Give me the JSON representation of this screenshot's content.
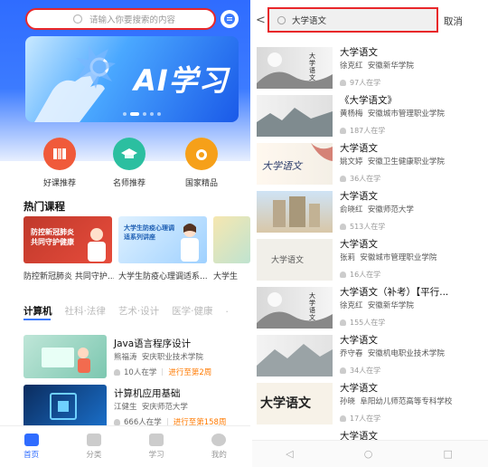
{
  "left": {
    "search": {
      "placeholder": "请输入你要搜索的内容"
    },
    "banner": {
      "text": "AI学习"
    },
    "quick_links": [
      {
        "label": "好课推荐",
        "icon": "books-icon",
        "color": "#f05a3a"
      },
      {
        "label": "名师推荐",
        "icon": "graduation-cap-icon",
        "color": "#2bbfa0"
      },
      {
        "label": "国家精品",
        "icon": "medal-icon",
        "color": "#f6a019"
      }
    ],
    "hot_title": "热门课程",
    "hot_courses": [
      {
        "caption": "防控新冠肺炎 共同守护...",
        "card_text": "防控新冠肺炎 共同守护健康"
      },
      {
        "caption": "大学生防疫心理调适系...",
        "card_text": "大学生防疫心理调适系列讲座"
      },
      {
        "caption": "大学生",
        "card_text": ""
      }
    ],
    "category_tabs": [
      "计算机",
      "社科·法律",
      "艺术·设计",
      "医学·健康",
      "."
    ],
    "courses": [
      {
        "title": "Java语言程序设计",
        "teacher": "熊福涛",
        "school": "安庆职业技术学院",
        "learners": "10人在学",
        "progress": "进行至第2周"
      },
      {
        "title": "计算机应用基础",
        "teacher": "江健生",
        "school": "安庆师范大学",
        "learners": "666人在学",
        "progress": "进行至第158周"
      }
    ],
    "tabbar": [
      {
        "label": "首页",
        "icon": "home-icon",
        "active": true
      },
      {
        "label": "分类",
        "icon": "grid-icon",
        "active": false
      },
      {
        "label": "学习",
        "icon": "study-icon",
        "active": false
      },
      {
        "label": "我的",
        "icon": "user-icon",
        "active": false
      }
    ]
  },
  "right": {
    "back": "<",
    "search": {
      "value": "大学语文"
    },
    "cancel": "取消",
    "results": [
      {
        "title": "大学语文",
        "teacher": "徐克红",
        "school": "安徽新华学院",
        "learners": "97人在学",
        "thumb_text": "大学语文"
      },
      {
        "title": "《大学语文》",
        "teacher": "黄杨梅",
        "school": "安徽城市管理职业学院",
        "learners": "187人在学",
        "thumb_text": ""
      },
      {
        "title": "大学语文",
        "teacher": "姚文婷",
        "school": "安徽卫生健康职业学院",
        "learners": "36人在学",
        "thumb_text": "大学语文"
      },
      {
        "title": "大学语文",
        "teacher": "俞晓红",
        "school": "安徽师范大学",
        "learners": "513人在学",
        "thumb_text": ""
      },
      {
        "title": "大学语文",
        "teacher": "张莉",
        "school": "安徽城市管理职业学院",
        "learners": "16人在学",
        "thumb_text": "大学语文"
      },
      {
        "title": "大学语文（补考）【平行...",
        "teacher": "徐克红",
        "school": "安徽新华学院",
        "learners": "155人在学",
        "thumb_text": "大学语文"
      },
      {
        "title": "大学语文",
        "teacher": "乔守春",
        "school": "安徽机电职业技术学院",
        "learners": "34人在学",
        "thumb_text": ""
      },
      {
        "title": "大学语文",
        "teacher": "孙晓",
        "school": "阜阳幼儿师范高等专科学校",
        "learners": "17人在学",
        "thumb_text": "大学语文"
      },
      {
        "title": "大学语文",
        "teacher": "",
        "school": "",
        "learners": "",
        "thumb_text": ""
      }
    ],
    "navbar": [
      "◁",
      "○",
      "□"
    ]
  }
}
